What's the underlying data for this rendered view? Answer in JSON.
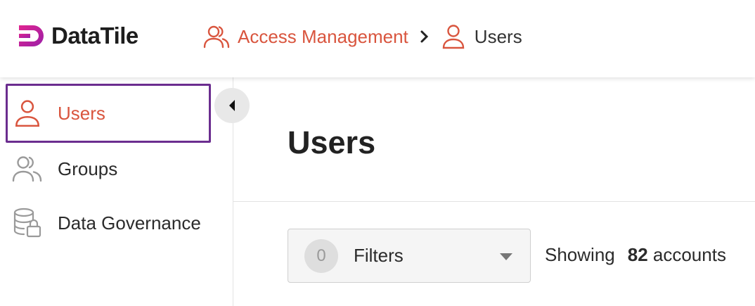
{
  "brand": {
    "name": "DataTile",
    "accent": "#d9553e",
    "logo_color": "#c0279b",
    "highlight_border": "#6b2d8f"
  },
  "breadcrumb": [
    {
      "label": "Access Management",
      "icon": "users-group-icon"
    },
    {
      "label": "Users",
      "icon": "user-icon"
    }
  ],
  "sidebar": {
    "items": [
      {
        "label": "Users",
        "icon": "user-icon",
        "active": true
      },
      {
        "label": "Groups",
        "icon": "users-group-icon",
        "active": false
      },
      {
        "label": "Data Governance",
        "icon": "database-lock-icon",
        "active": false
      }
    ]
  },
  "main": {
    "title": "Users",
    "filters": {
      "count": "0",
      "label": "Filters"
    },
    "showing": {
      "prefix": "Showing",
      "count": "82",
      "suffix": "accounts"
    }
  }
}
